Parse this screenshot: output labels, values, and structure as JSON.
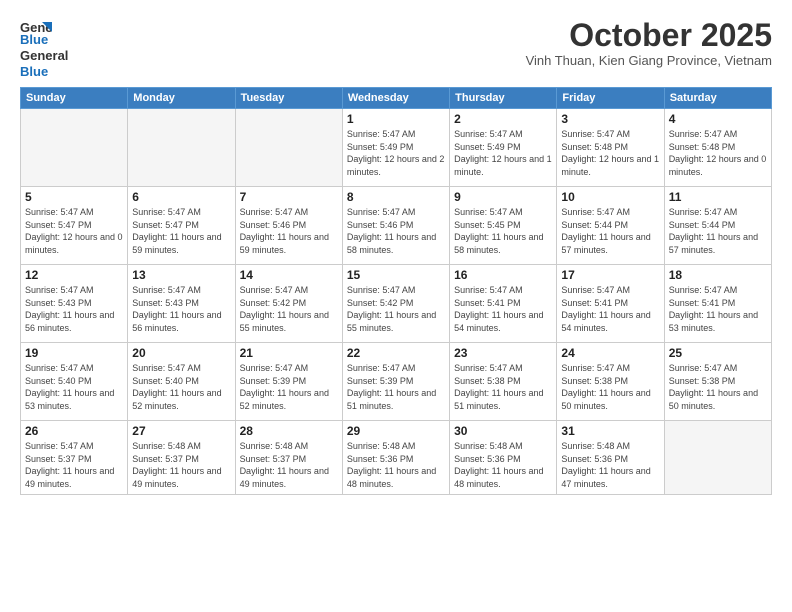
{
  "header": {
    "logo_general": "General",
    "logo_blue": "Blue",
    "month": "October 2025",
    "subtitle": "Vinh Thuan, Kien Giang Province, Vietnam"
  },
  "weekdays": [
    "Sunday",
    "Monday",
    "Tuesday",
    "Wednesday",
    "Thursday",
    "Friday",
    "Saturday"
  ],
  "weeks": [
    [
      {
        "day": "",
        "info": ""
      },
      {
        "day": "",
        "info": ""
      },
      {
        "day": "",
        "info": ""
      },
      {
        "day": "1",
        "info": "Sunrise: 5:47 AM\nSunset: 5:49 PM\nDaylight: 12 hours and 2 minutes."
      },
      {
        "day": "2",
        "info": "Sunrise: 5:47 AM\nSunset: 5:49 PM\nDaylight: 12 hours and 1 minute."
      },
      {
        "day": "3",
        "info": "Sunrise: 5:47 AM\nSunset: 5:48 PM\nDaylight: 12 hours and 1 minute."
      },
      {
        "day": "4",
        "info": "Sunrise: 5:47 AM\nSunset: 5:48 PM\nDaylight: 12 hours and 0 minutes."
      }
    ],
    [
      {
        "day": "5",
        "info": "Sunrise: 5:47 AM\nSunset: 5:47 PM\nDaylight: 12 hours and 0 minutes."
      },
      {
        "day": "6",
        "info": "Sunrise: 5:47 AM\nSunset: 5:47 PM\nDaylight: 11 hours and 59 minutes."
      },
      {
        "day": "7",
        "info": "Sunrise: 5:47 AM\nSunset: 5:46 PM\nDaylight: 11 hours and 59 minutes."
      },
      {
        "day": "8",
        "info": "Sunrise: 5:47 AM\nSunset: 5:46 PM\nDaylight: 11 hours and 58 minutes."
      },
      {
        "day": "9",
        "info": "Sunrise: 5:47 AM\nSunset: 5:45 PM\nDaylight: 11 hours and 58 minutes."
      },
      {
        "day": "10",
        "info": "Sunrise: 5:47 AM\nSunset: 5:44 PM\nDaylight: 11 hours and 57 minutes."
      },
      {
        "day": "11",
        "info": "Sunrise: 5:47 AM\nSunset: 5:44 PM\nDaylight: 11 hours and 57 minutes."
      }
    ],
    [
      {
        "day": "12",
        "info": "Sunrise: 5:47 AM\nSunset: 5:43 PM\nDaylight: 11 hours and 56 minutes."
      },
      {
        "day": "13",
        "info": "Sunrise: 5:47 AM\nSunset: 5:43 PM\nDaylight: 11 hours and 56 minutes."
      },
      {
        "day": "14",
        "info": "Sunrise: 5:47 AM\nSunset: 5:42 PM\nDaylight: 11 hours and 55 minutes."
      },
      {
        "day": "15",
        "info": "Sunrise: 5:47 AM\nSunset: 5:42 PM\nDaylight: 11 hours and 55 minutes."
      },
      {
        "day": "16",
        "info": "Sunrise: 5:47 AM\nSunset: 5:41 PM\nDaylight: 11 hours and 54 minutes."
      },
      {
        "day": "17",
        "info": "Sunrise: 5:47 AM\nSunset: 5:41 PM\nDaylight: 11 hours and 54 minutes."
      },
      {
        "day": "18",
        "info": "Sunrise: 5:47 AM\nSunset: 5:41 PM\nDaylight: 11 hours and 53 minutes."
      }
    ],
    [
      {
        "day": "19",
        "info": "Sunrise: 5:47 AM\nSunset: 5:40 PM\nDaylight: 11 hours and 53 minutes."
      },
      {
        "day": "20",
        "info": "Sunrise: 5:47 AM\nSunset: 5:40 PM\nDaylight: 11 hours and 52 minutes."
      },
      {
        "day": "21",
        "info": "Sunrise: 5:47 AM\nSunset: 5:39 PM\nDaylight: 11 hours and 52 minutes."
      },
      {
        "day": "22",
        "info": "Sunrise: 5:47 AM\nSunset: 5:39 PM\nDaylight: 11 hours and 51 minutes."
      },
      {
        "day": "23",
        "info": "Sunrise: 5:47 AM\nSunset: 5:38 PM\nDaylight: 11 hours and 51 minutes."
      },
      {
        "day": "24",
        "info": "Sunrise: 5:47 AM\nSunset: 5:38 PM\nDaylight: 11 hours and 50 minutes."
      },
      {
        "day": "25",
        "info": "Sunrise: 5:47 AM\nSunset: 5:38 PM\nDaylight: 11 hours and 50 minutes."
      }
    ],
    [
      {
        "day": "26",
        "info": "Sunrise: 5:47 AM\nSunset: 5:37 PM\nDaylight: 11 hours and 49 minutes."
      },
      {
        "day": "27",
        "info": "Sunrise: 5:48 AM\nSunset: 5:37 PM\nDaylight: 11 hours and 49 minutes."
      },
      {
        "day": "28",
        "info": "Sunrise: 5:48 AM\nSunset: 5:37 PM\nDaylight: 11 hours and 49 minutes."
      },
      {
        "day": "29",
        "info": "Sunrise: 5:48 AM\nSunset: 5:36 PM\nDaylight: 11 hours and 48 minutes."
      },
      {
        "day": "30",
        "info": "Sunrise: 5:48 AM\nSunset: 5:36 PM\nDaylight: 11 hours and 48 minutes."
      },
      {
        "day": "31",
        "info": "Sunrise: 5:48 AM\nSunset: 5:36 PM\nDaylight: 11 hours and 47 minutes."
      },
      {
        "day": "",
        "info": ""
      }
    ]
  ]
}
